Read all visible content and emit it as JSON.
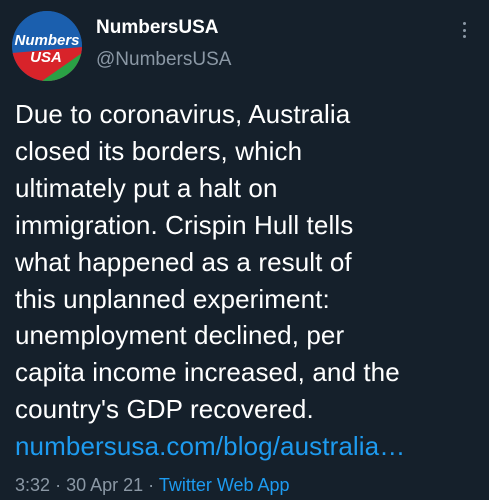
{
  "author": {
    "display_name": "NumbersUSA",
    "handle": "@NumbersUSA",
    "avatar_text_top": "Numbers",
    "avatar_text_bottom": "USA"
  },
  "tweet": {
    "text_lines": [
      "Due to coronavirus, Australia",
      "closed its borders, which",
      "ultimately put a halt on",
      "immigration. Crispin Hull tells",
      "what happened as a result of",
      "this unplanned experiment:",
      "unemployment declined, per",
      "capita income increased, and the",
      "country's GDP recovered."
    ],
    "link_text": "numbersusa.com/blog/australia…",
    "time": "3:32",
    "date": "30 Apr 21",
    "separator": "·",
    "source": "Twitter Web App"
  },
  "icons": {
    "more": "more-vertical-icon",
    "avatar": "numbersusa-logo"
  },
  "colors": {
    "background": "#15202b",
    "text": "#ffffff",
    "secondary": "#8b98a5",
    "link": "#1d9bf0",
    "avatar_blue": "#1b5fae",
    "avatar_red": "#d8232a",
    "avatar_green": "#2aa145"
  }
}
